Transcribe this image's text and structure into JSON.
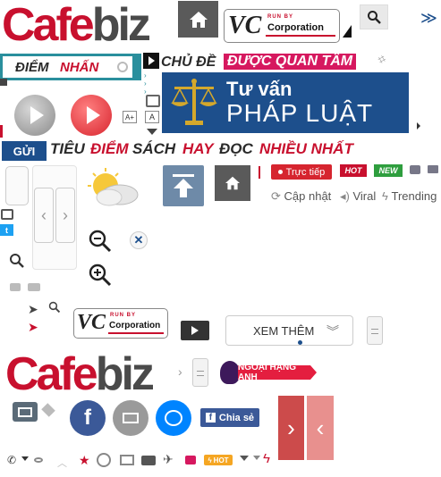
{
  "logo": {
    "part1": "Cafe",
    "part2": "biz"
  },
  "vcc": {
    "mark": "VC",
    "run_by": "RUN BY",
    "corporation": "Corporation"
  },
  "sections": {
    "diem_nhan": {
      "a": "ĐIỂM",
      "b": "NHẤN"
    },
    "chu_de": "CHỦ ĐỀ",
    "duoc_quan_tam": "ĐƯỢC QUAN TÂM",
    "tu_van": {
      "line1": "Tư vấn",
      "line2": "PHÁP LUẬT"
    },
    "gui": "GỬI",
    "tieu_diem": {
      "a": "TIÊU",
      "b": "ĐIỂM"
    },
    "sach_hay": {
      "a": "SÁCH",
      "b": "HAY"
    },
    "doc_nhieu_nhat": {
      "a": "ĐỌC",
      "b": "NHIỀU NHẤT"
    }
  },
  "badges": {
    "live": "Trực tiếp",
    "hot": "HOT",
    "new": "NEW"
  },
  "tabs": {
    "cap_nhat": "Cập nhật",
    "viral": "Viral",
    "trending": "Trending"
  },
  "buttons": {
    "xem_them": "XEM THÊM",
    "chia_se": "Chia sẻ",
    "hot_small": "HOT"
  },
  "ngoai_hang_anh": "NGOẠI HẠNG ANH",
  "font_size_labels": {
    "bigger": "A+",
    "normal": "A"
  },
  "colors": {
    "brand_red": "#c8102e",
    "pink": "#d6185f",
    "teal": "#2a8f9d",
    "navy": "#1d4f8c",
    "facebook": "#3b5998",
    "messenger": "#0084ff",
    "slate": "#6e8aa8",
    "gray_dark": "#5a5a5a"
  }
}
